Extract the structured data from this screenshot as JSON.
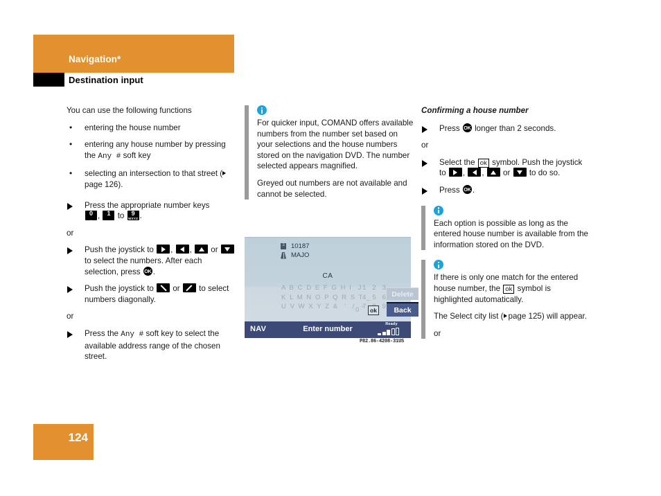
{
  "header": {
    "chapter": "Navigation*",
    "section": "Destination input",
    "band_color": "#e3902f"
  },
  "footer": {
    "page_number": "124",
    "band_color": "#e3902f"
  },
  "left_column": {
    "intro": "You can use the following functions",
    "bullets": [
      {
        "text_before": "entering the house number"
      },
      {
        "text_before": "entering any house number by pressing the ",
        "key": "Any  #",
        "text_after": " soft key"
      },
      {
        "text_before": "selecting an intersection to that street (",
        "page_ref": "page 126",
        "text_after": ")."
      }
    ],
    "steps": [
      {
        "lead": "Press the appropriate number keys",
        "keys": [
          {
            "digit": "0",
            "letters": "_"
          },
          {
            "digit": "1",
            "letters": ""
          },
          {
            "digit": "9",
            "letters": "WXYZ"
          }
        ],
        "joiner": "to"
      }
    ],
    "or_1": "or",
    "step_joystick_1a": "Push the joystick to",
    "step_joystick_1b": "to select the numbers. After each selection, press",
    "step_joystick_2a": "Push the joystick to",
    "step_joystick_2b": "to select numbers diagonally.",
    "or_2": "or",
    "step_anykey_a": "Press the",
    "step_anykey_key": "Any  #",
    "step_anykey_b": "soft key to select the available address range of the chosen street."
  },
  "middle_column": {
    "note": {
      "icon": "info-icon",
      "paragraph_1": "For quicker input, COMAND offers available numbers from the number set based on your selections and the house numbers stored on the navigation DVD. The number selected appears magnified.",
      "paragraph_2": "Greyed out numbers are not available and cannot be selected."
    },
    "screenshot": {
      "house_number": "10187",
      "street": "MAJO",
      "state": "CA",
      "keyboard_rows": [
        "A B C D E F G H I  J",
        "K L M N O P Q R S T _",
        "U V W X Y Z &  '  /  -"
      ],
      "number_rows": [
        "1 2 3",
        "4 5 6",
        "7 8 9"
      ],
      "zero": "0",
      "ok_symbol": "ok",
      "delete_button": "Delete",
      "back_button": "Back",
      "status_left": "NAV",
      "status_title": "Enter number",
      "status_ready": "Ready",
      "caption": "P82.86-4208-31US",
      "colors": {
        "screen_bg": "#c5d3dc",
        "status_bar": "#3d4a77",
        "back_button": "#4a5c8c",
        "delete_button": "#b9c6d2",
        "greyed_text": "#9aabb7"
      }
    }
  },
  "right_column": {
    "heading": "Confirming a house number",
    "step_1a": "Press",
    "step_1b": "longer than 2 seconds.",
    "or_1": "or",
    "step_2a": "Select the",
    "step_2b": "symbol. Push the joystick to",
    "step_2c": "to do so.",
    "step_3a": "Press",
    "step_3b": ".",
    "note_1": {
      "icon": "info-icon",
      "text": "Each option is possible as long as the entered house number is available from the information stored on the DVD."
    },
    "note_2": {
      "icon": "info-icon",
      "text_a": "If there is only one match for the entered house number, the",
      "ok_symbol": "ok",
      "text_b": "symbol is highlighted automatically.",
      "text_c_before": "The Select city list (",
      "page_ref": "page 125",
      "text_c_after": ") will appear.",
      "or": "or"
    }
  }
}
